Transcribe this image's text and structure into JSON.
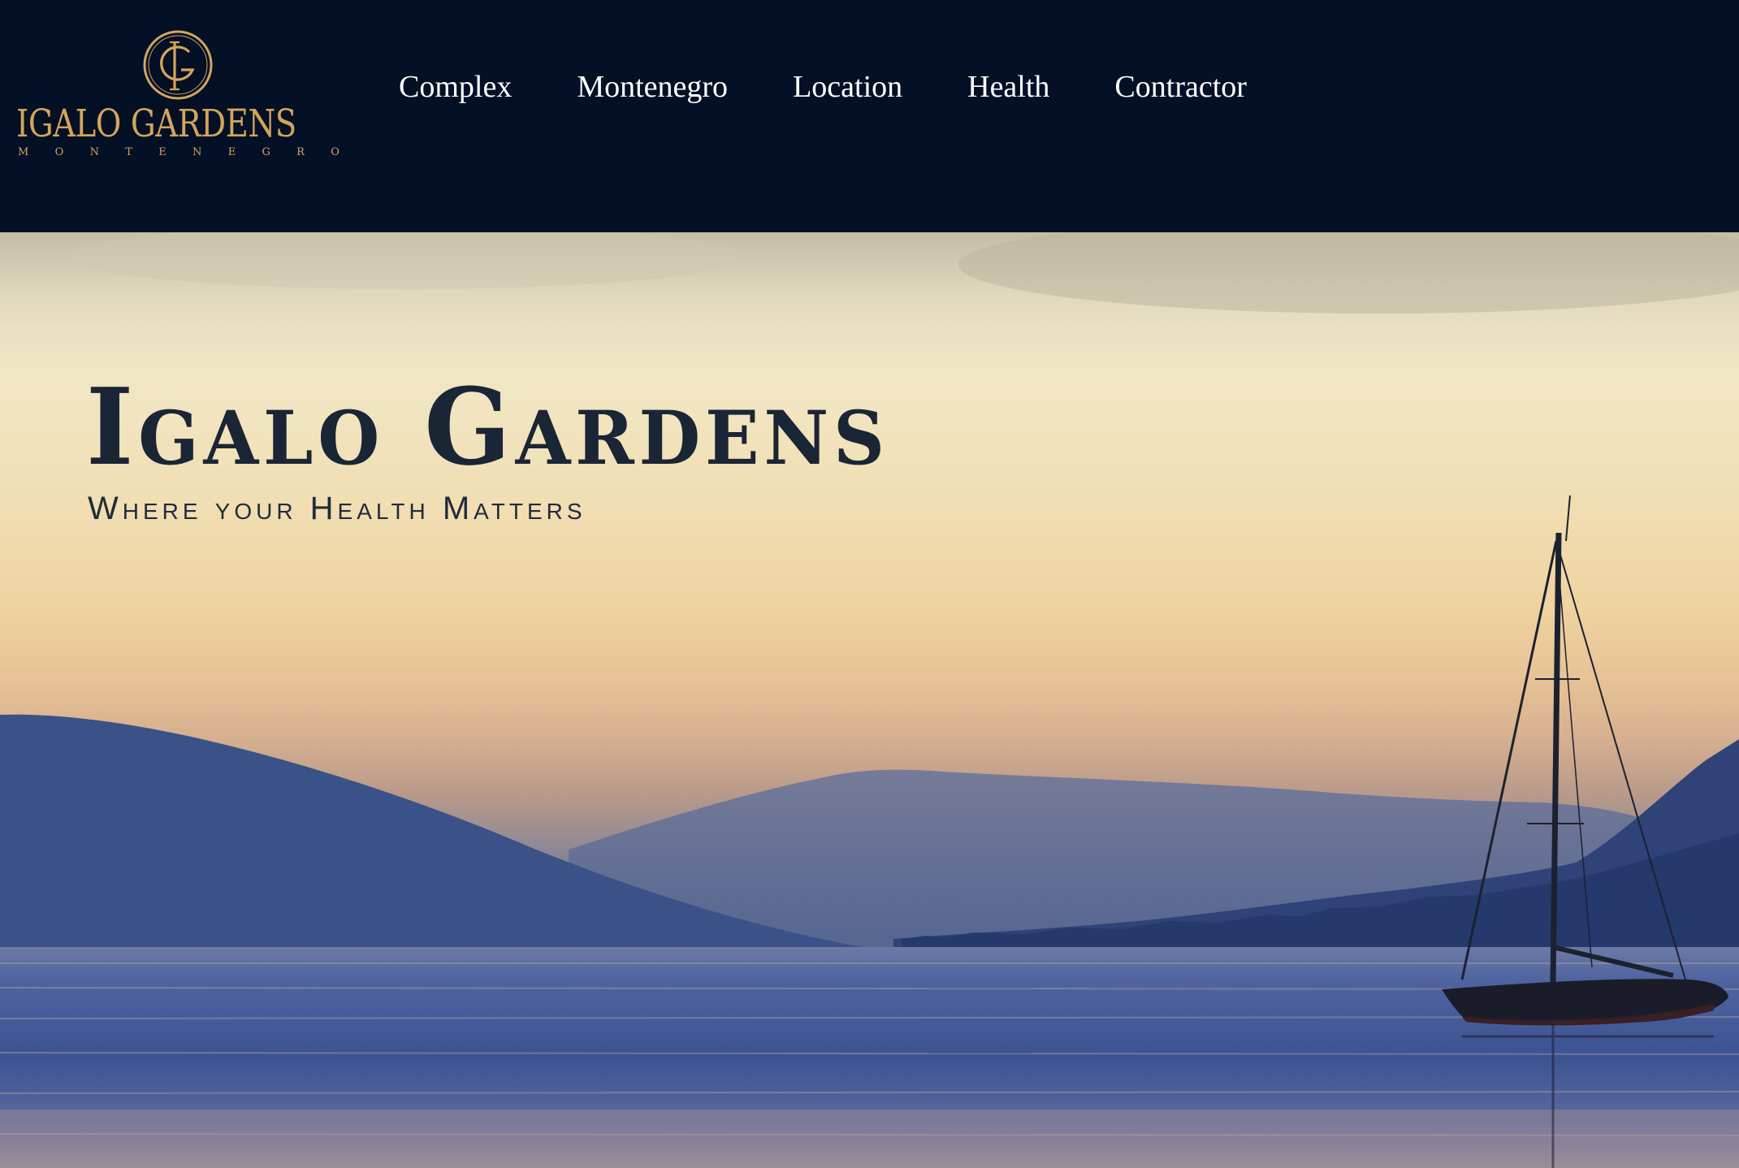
{
  "colors": {
    "header_bg": "#031026",
    "gold": "#d4a55a",
    "nav_text": "#ffffff",
    "hero_text": "#1a2535"
  },
  "logo": {
    "emblem_icon": "ig-monogram-icon",
    "wordmark": "IGALO GARDENS",
    "subline": "MONTENEGRO"
  },
  "nav": {
    "items": [
      {
        "label": "Complex"
      },
      {
        "label": "Montenegro"
      },
      {
        "label": "Location"
      },
      {
        "label": "Health"
      },
      {
        "label": "Contractor"
      }
    ]
  },
  "hero": {
    "title": "Igalo Gardens",
    "subtitle": "Where your Health Matters"
  }
}
